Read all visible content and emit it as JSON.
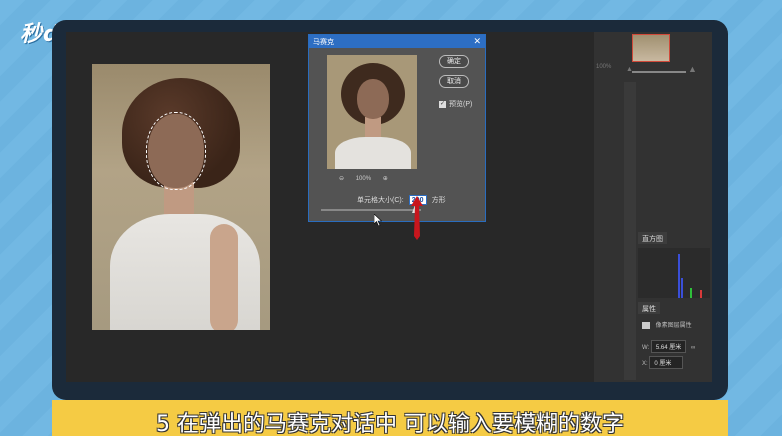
{
  "branding": {
    "logo_text": "秒dong视频"
  },
  "dialog": {
    "title": "马赛克",
    "ok_label": "确定",
    "cancel_label": "取消",
    "preview_label": "预览(P)",
    "preview_checked": true,
    "zoom_level": "100%",
    "cell_size_label": "单元格大小(C):",
    "cell_size_value": "200",
    "cell_size_unit": "方形"
  },
  "panels": {
    "navigator_zoom": "100%",
    "histogram_tab": "直方图",
    "properties_tab": "属性",
    "layer_type": "像素图层属性",
    "width_label": "W:",
    "width_value": "5.64 厘米",
    "x_label": "X:",
    "x_value": "0 厘米"
  },
  "subtitle": {
    "text": "5 在弹出的马赛克对话中 可以输入要模糊的数字"
  },
  "colors": {
    "accent_blue": "#2d6ec3",
    "subtitle_bg": "#f5cb44",
    "sky_bg": "#6fb6e2"
  }
}
